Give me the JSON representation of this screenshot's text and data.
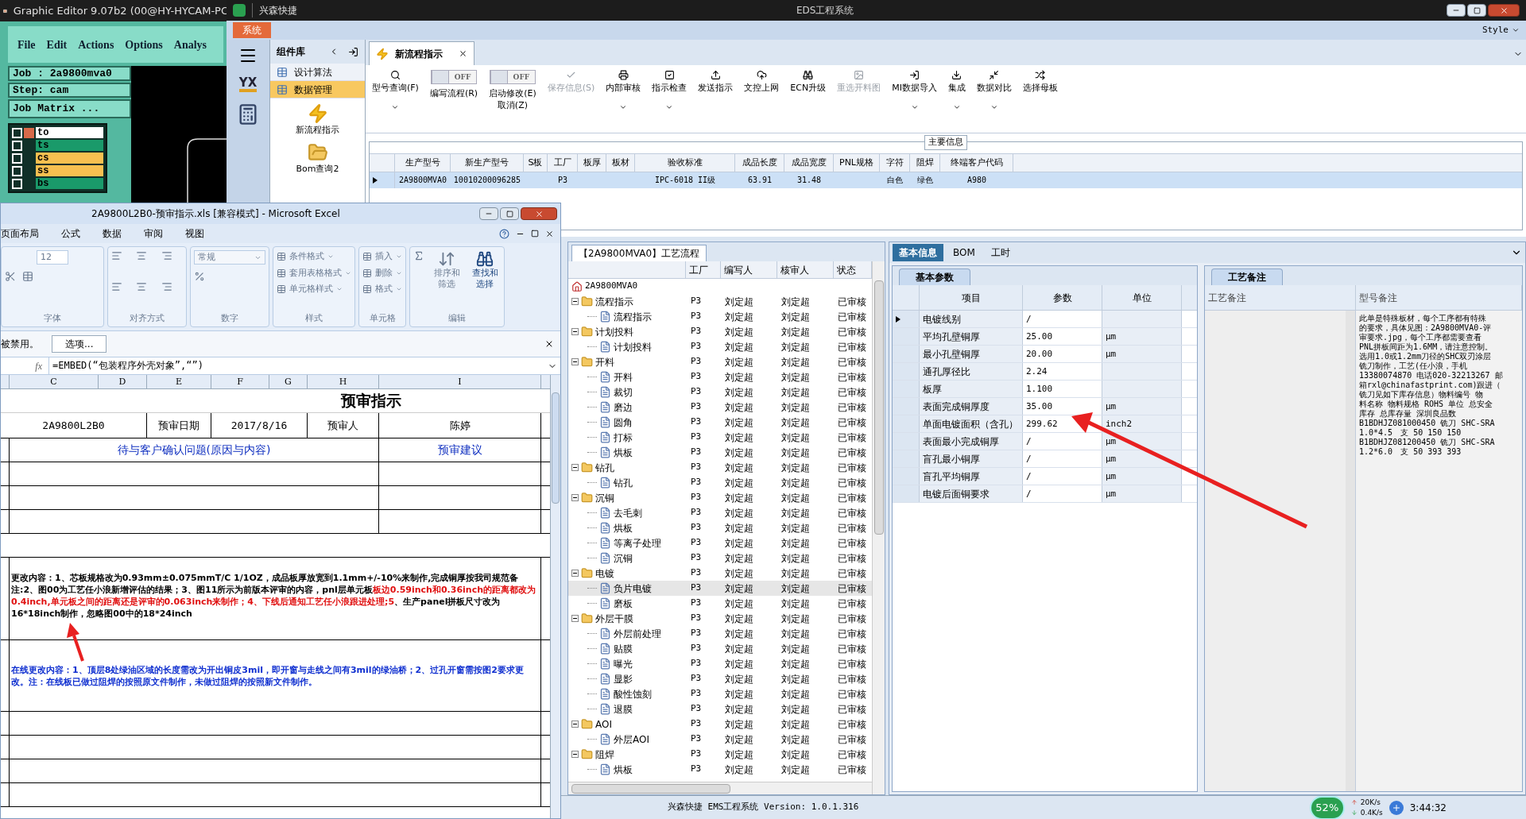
{
  "graphic_editor": {
    "title": "Graphic Editor 9.07b2 (00@HY-HYCAM-PC",
    "menu": [
      "File",
      "Edit",
      "Actions",
      "Options",
      "Analys"
    ],
    "job": "Job : 2a9800mva0",
    "step": "Step: cam",
    "matrix_button": "Job Matrix ...",
    "layers": [
      {
        "name": "to",
        "color": "#ffffff",
        "selected": true,
        "checked": false
      },
      {
        "name": "ts",
        "color": "#1a9a6a",
        "selected": false,
        "checked": false
      },
      {
        "name": "cs",
        "color": "#f8c050",
        "selected": false,
        "checked": false
      },
      {
        "name": "ss",
        "color": "#f8c050",
        "selected": false,
        "checked": false
      },
      {
        "name": "bs",
        "color": "#1a9a6a",
        "selected": false,
        "checked": false
      }
    ]
  },
  "ems": {
    "app_name": "兴森快捷",
    "title": "EDS工程系统",
    "menu_tab": "系统",
    "style_menu": "Style",
    "logo_text": "YX",
    "component_library": {
      "title": "组件库",
      "items": [
        {
          "label": "设计算法",
          "selected": false
        },
        {
          "label": "数据管理",
          "selected": true
        }
      ],
      "tools": [
        "新流程指示",
        "Bom查询2"
      ]
    },
    "doc_tab": "新流程指示",
    "toolbar": [
      {
        "kind": "button",
        "label": "型号查询(F)",
        "dropdown": true,
        "disabled": false
      },
      {
        "kind": "toggle",
        "switch_text": "OFF",
        "on": false,
        "label_lines": [
          "编写流程(R)"
        ]
      },
      {
        "kind": "toggle",
        "switch_text": "OFF",
        "on": false,
        "label_lines": [
          "启动修改(E)",
          "取消(Z)"
        ]
      },
      {
        "kind": "button",
        "label": "保存信息(S)",
        "dropdown": false,
        "disabled": true
      },
      {
        "kind": "button",
        "label": "内部审核",
        "dropdown": true,
        "disabled": false
      },
      {
        "kind": "button",
        "label": "指示检查",
        "dropdown": true,
        "disabled": false
      },
      {
        "kind": "button",
        "label": "发送指示",
        "dropdown": false,
        "disabled": false
      },
      {
        "kind": "button",
        "label": "文控上网",
        "dropdown": false,
        "disabled": false
      },
      {
        "kind": "button",
        "label": "ECN升级",
        "dropdown": false,
        "disabled": false
      },
      {
        "kind": "button",
        "label": "重选开料图",
        "dropdown": false,
        "disabled": true
      },
      {
        "kind": "button",
        "label": "MI数据导入",
        "dropdown": true,
        "disabled": false
      },
      {
        "kind": "button",
        "label": "集成",
        "dropdown": true,
        "disabled": false
      },
      {
        "kind": "button",
        "label": "数据对比",
        "dropdown": true,
        "disabled": false
      },
      {
        "kind": "button",
        "label": "选择母板",
        "dropdown": false,
        "disabled": false
      }
    ],
    "main_info": {
      "title": "主要信息",
      "columns": [
        "生产型号",
        "新生产型号",
        "S板",
        "工厂",
        "板厚",
        "板材",
        "验收标准",
        "成品长度",
        "成品宽度",
        "PNL规格",
        "字符",
        "阻焊",
        "终端客户代码"
      ],
      "rows": [
        {
          "selected": true,
          "cells": [
            "2A9800MVA0",
            "10010200096285",
            "",
            "P3",
            "",
            "",
            "IPC-6018 II级",
            "63.91",
            "31.48",
            "",
            "白色",
            "绿色",
            "A980"
          ]
        }
      ]
    },
    "process": {
      "tab": "【2A9800MVA0】工艺流程",
      "columns": [
        "工厂",
        "编写人",
        "核审人",
        "状态"
      ],
      "tree": {
        "label": "2A9800MVA0",
        "children": [
          {
            "label": "流程指示",
            "factory": "P3",
            "author": "刘定超",
            "reviewer": "刘定超",
            "status": "已审核",
            "selected": false,
            "expanded": true,
            "children": [
              {
                "label": "流程指示",
                "factory": "P3",
                "author": "刘定超",
                "reviewer": "刘定超",
                "status": "已审核",
                "selected": false
              }
            ]
          },
          {
            "label": "计划投料",
            "factory": "P3",
            "author": "刘定超",
            "reviewer": "刘定超",
            "status": "已审核",
            "selected": false,
            "expanded": true,
            "children": [
              {
                "label": "计划投料",
                "factory": "P3",
                "author": "刘定超",
                "reviewer": "刘定超",
                "status": "已审核",
                "selected": false
              }
            ]
          },
          {
            "label": "开料",
            "factory": "P3",
            "author": "刘定超",
            "reviewer": "刘定超",
            "status": "已审核",
            "selected": false,
            "expanded": true,
            "children": [
              {
                "label": "开料",
                "factory": "P3",
                "author": "刘定超",
                "reviewer": "刘定超",
                "status": "已审核",
                "selected": false
              },
              {
                "label": "裁切",
                "factory": "P3",
                "author": "刘定超",
                "reviewer": "刘定超",
                "status": "已审核",
                "selected": false
              },
              {
                "label": "磨边",
                "factory": "P3",
                "author": "刘定超",
                "reviewer": "刘定超",
                "status": "已审核",
                "selected": false
              },
              {
                "label": "圆角",
                "factory": "P3",
                "author": "刘定超",
                "reviewer": "刘定超",
                "status": "已审核",
                "selected": false
              },
              {
                "label": "打标",
                "factory": "P3",
                "author": "刘定超",
                "reviewer": "刘定超",
                "status": "已审核",
                "selected": false
              },
              {
                "label": "烘板",
                "factory": "P3",
                "author": "刘定超",
                "reviewer": "刘定超",
                "status": "已审核",
                "selected": false
              }
            ]
          },
          {
            "label": "钻孔",
            "factory": "P3",
            "author": "刘定超",
            "reviewer": "刘定超",
            "status": "已审核",
            "selected": false,
            "expanded": true,
            "children": [
              {
                "label": "钻孔",
                "factory": "P3",
                "author": "刘定超",
                "reviewer": "刘定超",
                "status": "已审核",
                "selected": false
              }
            ]
          },
          {
            "label": "沉铜",
            "factory": "P3",
            "author": "刘定超",
            "reviewer": "刘定超",
            "status": "已审核",
            "selected": false,
            "expanded": true,
            "children": [
              {
                "label": "去毛刺",
                "factory": "P3",
                "author": "刘定超",
                "reviewer": "刘定超",
                "status": "已审核",
                "selected": false
              },
              {
                "label": "烘板",
                "factory": "P3",
                "author": "刘定超",
                "reviewer": "刘定超",
                "status": "已审核",
                "selected": false
              },
              {
                "label": "等离子处理",
                "factory": "P3",
                "author": "刘定超",
                "reviewer": "刘定超",
                "status": "已审核",
                "selected": false
              },
              {
                "label": "沉铜",
                "factory": "P3",
                "author": "刘定超",
                "reviewer": "刘定超",
                "status": "已审核",
                "selected": false
              }
            ]
          },
          {
            "label": "电镀",
            "factory": "P3",
            "author": "刘定超",
            "reviewer": "刘定超",
            "status": "已审核",
            "selected": false,
            "expanded": true,
            "children": [
              {
                "label": "负片电镀",
                "factory": "P3",
                "author": "刘定超",
                "reviewer": "刘定超",
                "status": "已审核",
                "selected": true
              },
              {
                "label": "磨板",
                "factory": "P3",
                "author": "刘定超",
                "reviewer": "刘定超",
                "status": "已审核",
                "selected": false
              }
            ]
          },
          {
            "label": "外层干膜",
            "factory": "P3",
            "author": "刘定超",
            "reviewer": "刘定超",
            "status": "已审核",
            "selected": false,
            "expanded": true,
            "children": [
              {
                "label": "外层前处理",
                "factory": "P3",
                "author": "刘定超",
                "reviewer": "刘定超",
                "status": "已审核",
                "selected": false
              },
              {
                "label": "贴膜",
                "factory": "P3",
                "author": "刘定超",
                "reviewer": "刘定超",
                "status": "已审核",
                "selected": false
              },
              {
                "label": "曝光",
                "factory": "P3",
                "author": "刘定超",
                "reviewer": "刘定超",
                "status": "已审核",
                "selected": false
              },
              {
                "label": "显影",
                "factory": "P3",
                "author": "刘定超",
                "reviewer": "刘定超",
                "status": "已审核",
                "selected": false
              },
              {
                "label": "酸性蚀刻",
                "factory": "P3",
                "author": "刘定超",
                "reviewer": "刘定超",
                "status": "已审核",
                "selected": false
              },
              {
                "label": "退膜",
                "factory": "P3",
                "author": "刘定超",
                "reviewer": "刘定超",
                "status": "已审核",
                "selected": false
              }
            ]
          },
          {
            "label": "AOI",
            "factory": "P3",
            "author": "刘定超",
            "reviewer": "刘定超",
            "status": "已审核",
            "selected": false,
            "expanded": true,
            "children": [
              {
                "label": "外层AOI",
                "factory": "P3",
                "author": "刘定超",
                "reviewer": "刘定超",
                "status": "已审核",
                "selected": false
              }
            ]
          },
          {
            "label": "阻焊",
            "factory": "P3",
            "author": "刘定超",
            "reviewer": "刘定超",
            "status": "已审核",
            "selected": false,
            "expanded": true,
            "children": [
              {
                "label": "烘板",
                "factory": "P3",
                "author": "刘定超",
                "reviewer": "刘定超",
                "status": "已审核",
                "selected": false
              }
            ]
          }
        ]
      }
    },
    "info_tabs": [
      {
        "label": "基本信息",
        "selected": true
      },
      {
        "label": "BOM",
        "selected": false
      },
      {
        "label": "工时",
        "selected": false
      }
    ],
    "basic_params": {
      "tab": "基本参数",
      "columns": [
        "项目",
        "参数",
        "单位"
      ],
      "rows": [
        {
          "item": "电镀线别",
          "value": "/",
          "unit": "",
          "selected": true
        },
        {
          "item": "平均孔壁铜厚",
          "value": "25.00",
          "unit": "μm",
          "selected": false
        },
        {
          "item": "最小孔壁铜厚",
          "value": "20.00",
          "unit": "μm",
          "selected": false
        },
        {
          "item": "通孔厚径比",
          "value": "2.24",
          "unit": "",
          "selected": false
        },
        {
          "item": "板厚",
          "value": "1.100",
          "unit": "",
          "selected": false
        },
        {
          "item": "表面完成铜厚度",
          "value": "35.00",
          "unit": "μm",
          "selected": false
        },
        {
          "item": "单面电镀面积（含孔）",
          "value": "299.62",
          "unit": "inch2",
          "selected": false
        },
        {
          "item": "表面最小完成铜厚",
          "value": "/",
          "unit": "μm",
          "selected": false
        },
        {
          "item": "盲孔最小铜厚",
          "value": "/",
          "unit": "μm",
          "selected": false
        },
        {
          "item": "盲孔平均铜厚",
          "value": "/",
          "unit": "μm",
          "selected": false
        },
        {
          "item": "电镀后面铜要求",
          "value": "/",
          "unit": "μm",
          "selected": false
        }
      ]
    },
    "remarks": {
      "tab": "工艺备注",
      "columns": [
        "工艺备注",
        "型号备注"
      ],
      "model_note_lines": [
        "此单是特殊板材，每个工序都有特殊",
        "的要求，具体见图：2A9800MVA0-评",
        "审要求.jpg，每个工序都需要查看",
        "PNL拼板间距为1.6MM，请注意控制。",
        "选用1.0或1.2mm刀径的SHC双刃涂层",
        "铣刀制作，工艺(任小浪，手机",
        "13380074870 电话020-32213267 邮",
        "箱rxl@chinafastprint.com)跟进（",
        "铣刀见如下库存信息）物料编号 物",
        "料名称 物料规格 ROHS 单位 总安全",
        "库存 总库存量 深圳良品数",
        "B1BDHJZ081000450 铣刀 SHC-SRA",
        "1.0*4.5　支 50 150 150",
        "B1BDHJZ081200450 铣刀 SHC-SRA",
        "1.2*6.0　支 50 393 393"
      ]
    },
    "status": "兴森快捷 EMS工程系统 Version: 1.0.1.316",
    "tray": {
      "gauge": "52%",
      "upload": "20K/s",
      "download": "0.4K/s",
      "clock": "3:44:32"
    }
  },
  "excel": {
    "title": "2A9800L2B0-预审指示.xls  [兼容模式] - Microsoft Excel",
    "tabs": [
      "页面布局",
      "公式",
      "数据",
      "审阅",
      "视图"
    ],
    "ribbon": [
      {
        "kind": "font",
        "label": "字体",
        "value": "12"
      },
      {
        "kind": "align",
        "label": "对齐方式"
      },
      {
        "kind": "number",
        "label": "数字",
        "value": "常规"
      },
      {
        "kind": "list",
        "label": "样式",
        "items": [
          "条件格式",
          "套用表格格式",
          "单元格样式"
        ]
      },
      {
        "kind": "list",
        "label": "单元格",
        "items": [
          "插入",
          "删除",
          "格式"
        ]
      },
      {
        "kind": "edit",
        "label": "编辑",
        "items": [
          "排序和筛选",
          "查找和选择"
        ]
      }
    ],
    "message": "被禁用。",
    "message_button": "选项...",
    "function_label": "fx",
    "formula": "=EMBED(“包装程序外壳对象”,“”)",
    "sheet": {
      "columns": [
        "C",
        "D",
        "E",
        "F",
        "G",
        "H",
        "I"
      ],
      "title": "预审指示",
      "info": [
        "2A9800L2B0",
        "预审日期",
        "2017/8/16",
        "预审人",
        "陈婷"
      ],
      "headers": [
        "待与客户确认问题(原因与内容)",
        "预审建议"
      ],
      "notes": [
        {
          "segments": [
            {
              "text": "更改内容：1、芯板规格改为0.93mm±0.075mmT/C 1/1OZ，成品板厚放宽到1.1mm+/-10%来制作,完成铜厚按我司规范备注:2、图00为工艺任小浪新增评估的结果；3、图11所示为前版本评审的内容，pnl层单元板",
              "color": "#000000"
            },
            {
              "text": "板边0.59inch和0.36inch的距离都改为0.4inch,单元板之间的距离还是评审的0.063inch来制作；4、下线后通知工艺任小浪跟进处理;5",
              "color": "#e01010"
            },
            {
              "text": "、生产panel拼板尺寸改为16*18inch制作，忽略图00中的18*24inch",
              "color": "#000000"
            }
          ]
        },
        {
          "segments": [
            {
              "text": "在线更改内容：1、顶层8处绿油区域的长度需改为开出铜皮3mil，即开窗与走线之间有3mil的绿油桥；2、过孔开窗需按图2要求更改。注：在线板已做过阻焊的按照原文件制作，未做过阻焊的按照新文件制作。",
              "color": "#1030d0"
            }
          ]
        }
      ]
    }
  }
}
